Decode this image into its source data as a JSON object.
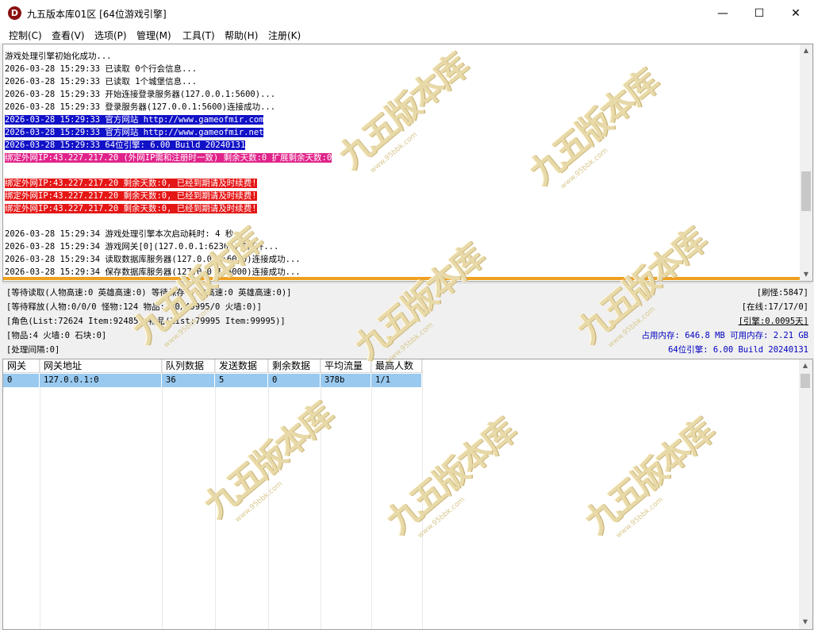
{
  "window": {
    "title": "九五版本库01区 [64位游戏引擎]",
    "icon_letter": "D",
    "controls": [
      "—",
      "☐",
      "✕"
    ]
  },
  "menu": [
    {
      "label": "控制(C)"
    },
    {
      "label": "查看(V)"
    },
    {
      "label": "选项(P)"
    },
    {
      "label": "管理(M)"
    },
    {
      "label": "工具(T)"
    },
    {
      "label": "帮助(H)"
    },
    {
      "label": "注册(K)"
    }
  ],
  "log": {
    "lines": [
      {
        "text": "游戏处理引擎初始化成功...",
        "style": ""
      },
      {
        "text": "2026-03-28 15:29:33 已读取 0个行会信息...",
        "style": ""
      },
      {
        "text": "2026-03-28 15:29:33 已读取 1个城堡信息...",
        "style": ""
      },
      {
        "text": "2026-03-28 15:29:33 开始连接登录服务器(127.0.0.1:5600)...",
        "style": ""
      },
      {
        "text": "2026-03-28 15:29:33 登录服务器(127.0.0.1:5600)连接成功...",
        "style": ""
      },
      {
        "text": "2026-03-28 15:29:33 官方网站 http://www.gameofmir.com",
        "style": "blue"
      },
      {
        "text": "2026-03-28 15:29:33 官方网站 http://www.gameofmir.net",
        "style": "blue"
      },
      {
        "text": "2026-03-28 15:29:33 64位引擎: 6.00 Build 20240131",
        "style": "blue"
      },
      {
        "text": "绑定外网IP:43.227.217.20 (外网IP需和注册时一致) 剩余天数:0 扩展剩余天数:0",
        "style": "pink"
      },
      {
        "text": "",
        "style": ""
      },
      {
        "text": "绑定外网IP:43.227.217.20 剩余天数:0, 已经到期请及时续费!",
        "style": "red"
      },
      {
        "text": "绑定外网IP:43.227.217.20 剩余天数:0, 已经到期请及时续费!",
        "style": "red"
      },
      {
        "text": "绑定外网IP:43.227.217.20 剩余天数:0, 已经到期请及时续费!",
        "style": "red"
      },
      {
        "text": "",
        "style": ""
      },
      {
        "text": "2026-03-28 15:29:34 游戏处理引擎本次启动耗时: 4 秒",
        "style": ""
      },
      {
        "text": "2026-03-28 15:29:34 游戏网关[0](127.0.0.1:62305)已打开...",
        "style": ""
      },
      {
        "text": "2026-03-28 15:29:34 读取数据库服务器(127.0.0.1:6000)连接成功...",
        "style": ""
      },
      {
        "text": "2026-03-28 15:29:34 保存数据库服务器(127.0.0.1:6000)连接成功...",
        "style": ""
      }
    ]
  },
  "status": {
    "left": [
      "[等待读取(人物高速:0 英雄高速:0) 等待保存(人物高速:0 英雄高速:0)]",
      "[等待释放(人物:0/0/0 怪物:124 物品:170/49995/0 火墙:0)]",
      "[角色(List:72624 Item:92485) 物品(List:79995 Item:99995)]",
      "[物品:4 火墙:0 石块:0]",
      "[处理间隔:0]"
    ],
    "right": {
      "refresh": "[刷怪:5847]",
      "online": "[在线:17/17/0]",
      "engine": "[引擎:0.0095天]",
      "memory": "占用内存: 646.8 MB 可用内存: 2.21 GB",
      "build": "64位引擎: 6.00 Build 20240131"
    }
  },
  "gateway_table": {
    "columns": [
      "网关",
      "网关地址",
      "队列数据",
      "发送数据",
      "剩余数据",
      "平均流量",
      "最高人数"
    ],
    "rows": [
      [
        "0",
        "127.0.0.1:0",
        "36",
        "5",
        "0",
        "378b",
        "1/1"
      ]
    ]
  },
  "watermark": {
    "main": "九五版本库",
    "sub": "www.95bbk.com"
  }
}
